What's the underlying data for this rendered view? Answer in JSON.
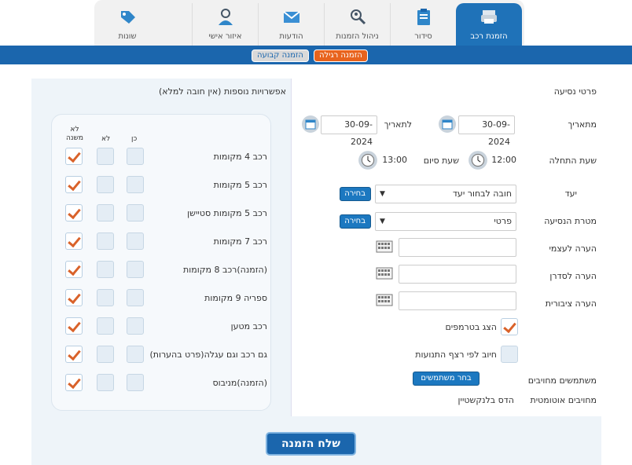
{
  "tabs": [
    {
      "label": "הזמנת רכב",
      "icon": "printer-icon",
      "active": true
    },
    {
      "label": "סידור",
      "icon": "clipboard-icon",
      "active": false
    },
    {
      "label": "ניהול הזמנות",
      "icon": "search-person-icon",
      "active": false
    },
    {
      "label": "הודעות",
      "icon": "envelope-icon",
      "active": false
    },
    {
      "label": "איזור אישי",
      "icon": "user-icon",
      "active": false
    },
    {
      "label": "שונות",
      "icon": "tag-icon",
      "active": false
    }
  ],
  "subtabs": {
    "regular": "הזמנה רגילה",
    "fixed": "הזמנה קבועה"
  },
  "trip": {
    "header": "פרטי נסיעה",
    "from_date_label": "מתאריך",
    "from_date": "30-09-2024",
    "to_date_label": "לתאריך",
    "to_date": "30-09-2024",
    "start_time_label": "שעת התחלה",
    "start_time": "12:00",
    "end_time_label": "שעת סיום",
    "end_time": "13:00",
    "destination_label": "יעד",
    "destination_value": "חובה לבחור יעד",
    "destination_btn": "בחירה",
    "purpose_label": "מטרת הנסיעה",
    "purpose_value": "פרטי",
    "purpose_btn": "בחירה",
    "note_self_label": "הערה לעצמי",
    "note_scheduler_label": "הערה לסדרן",
    "note_public_label": "הערה ציבורית",
    "show_trampists_label": "הצג בטרמפים",
    "billing_label": "חיוב לפי רצף התנועות",
    "billed_users_label": "משתמשים מחויבים",
    "billed_users_btn": "בחר משתמשים",
    "auto_billed_label": "מחויבים אוטומטית",
    "auto_billed_value": "הדס בלנקשטיין"
  },
  "options": {
    "header": "אפשרויות נוספות (אין חובה למלא)",
    "col_yes": "כן",
    "col_no": "לא",
    "col_nomatter": "לא משנה",
    "rows": [
      {
        "label": "רכב 4 מקומות",
        "state": "nomatter"
      },
      {
        "label": "רכב 5 מקומות",
        "state": "nomatter"
      },
      {
        "label": "רכב 5 מקומות סטיישן",
        "state": "nomatter"
      },
      {
        "label": "רכב 7 מקומות",
        "state": "nomatter"
      },
      {
        "label": "(הזמנה)רכב 8 מקומות",
        "state": "nomatter"
      },
      {
        "label": "ספריה 9 מקומות",
        "state": "nomatter"
      },
      {
        "label": "רכב מטען",
        "state": "nomatter"
      },
      {
        "label": "גם רכב וגם עגלה(פרט בהערות)",
        "state": "nomatter"
      },
      {
        "label": "(הזמנה)מניבוס",
        "state": "nomatter"
      }
    ]
  },
  "send_label": "שלח הזמנה",
  "colors": {
    "primary": "#1b66ad",
    "accent": "#e8631d",
    "check": "#d9622a"
  }
}
